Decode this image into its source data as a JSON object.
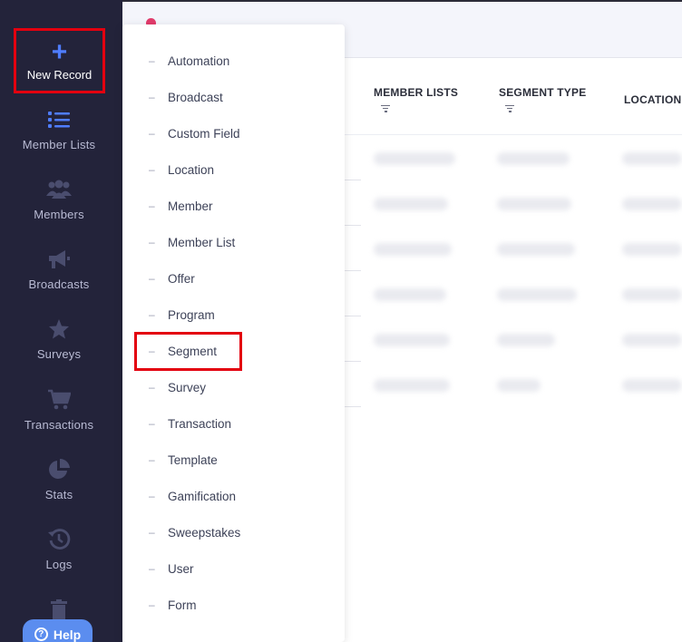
{
  "sidebar": {
    "new_record_label": "New Record",
    "items": [
      {
        "label": "Member Lists",
        "icon": "list-icon"
      },
      {
        "label": "Members",
        "icon": "users-icon"
      },
      {
        "label": "Broadcasts",
        "icon": "megaphone-icon"
      },
      {
        "label": "Surveys",
        "icon": "star-icon"
      },
      {
        "label": "Transactions",
        "icon": "cart-icon"
      },
      {
        "label": "Stats",
        "icon": "pie-chart-icon"
      },
      {
        "label": "Logs",
        "icon": "history-icon"
      }
    ],
    "help_label": "Help"
  },
  "table": {
    "columns": [
      "MEMBER LISTS",
      "SEGMENT TYPE",
      "LOCATION"
    ]
  },
  "menu": {
    "items": [
      "Automation",
      "Broadcast",
      "Custom Field",
      "Location",
      "Member",
      "Member List",
      "Offer",
      "Program",
      "Segment",
      "Survey",
      "Transaction",
      "Template",
      "Gamification",
      "Sweepstakes",
      "User",
      "Form"
    ],
    "dash": "–",
    "highlighted": "Segment"
  },
  "colors": {
    "sidebar_bg": "#23233a",
    "accent_blue": "#4f7dff",
    "highlight_red": "#e3000f",
    "help_bg": "#5b8def"
  }
}
